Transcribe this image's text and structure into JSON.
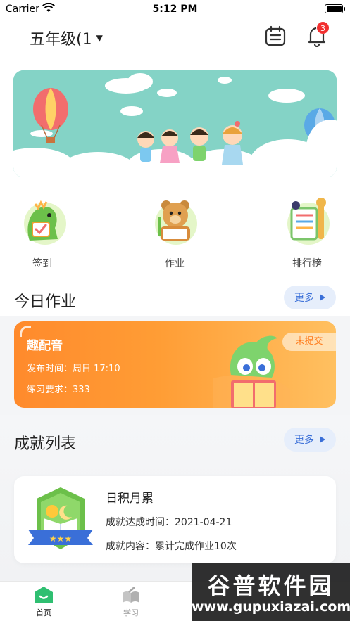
{
  "status_bar": {
    "carrier": "Carrier",
    "time": "5:12 PM"
  },
  "header": {
    "class_name": "五年级(1",
    "notification_count": "3"
  },
  "quick_nav": [
    {
      "label": "签到"
    },
    {
      "label": "作业"
    },
    {
      "label": "排行榜"
    }
  ],
  "homework": {
    "section_title": "今日作业",
    "more_label": "更多",
    "card": {
      "title": "趣配音",
      "publish_time": "发布时间：周日 17:10",
      "requirement": "练习要求：333",
      "status": "未提交"
    }
  },
  "achievements": {
    "section_title": "成就列表",
    "more_label": "更多",
    "item": {
      "name": "日积月累",
      "achieved_time": "成就达成时间：2021-04-21",
      "content": "成就内容：累计完成作业10次"
    }
  },
  "tabbar": [
    {
      "label": "首页",
      "icon": "home-icon",
      "active": true
    },
    {
      "label": "学习",
      "icon": "study-icon",
      "active": false
    }
  ],
  "watermark": {
    "title": "谷普软件园",
    "url": "www.gupuxiazai.com"
  },
  "colors": {
    "accent": "#3a6fd8",
    "tab_active": "#2fbf71",
    "homework_card": "#ff9d35",
    "badge": "#f23030"
  }
}
